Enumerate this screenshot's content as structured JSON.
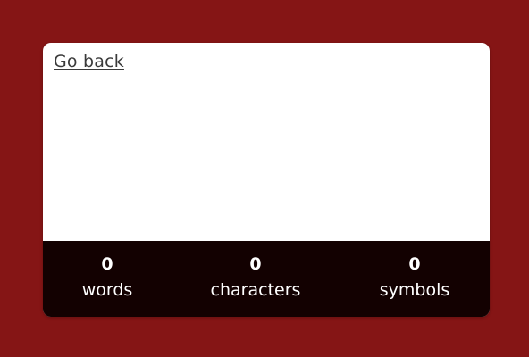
{
  "colors": {
    "background": "#851515",
    "card": "#ffffff",
    "stats_bar": "#130101",
    "stats_text": "#ffffff",
    "link": "#3a3a3a"
  },
  "nav": {
    "go_back_label": "Go back"
  },
  "editor": {
    "value": ""
  },
  "stats": {
    "words": {
      "count": "0",
      "label": "words"
    },
    "characters": {
      "count": "0",
      "label": "characters"
    },
    "symbols": {
      "count": "0",
      "label": "symbols"
    }
  }
}
